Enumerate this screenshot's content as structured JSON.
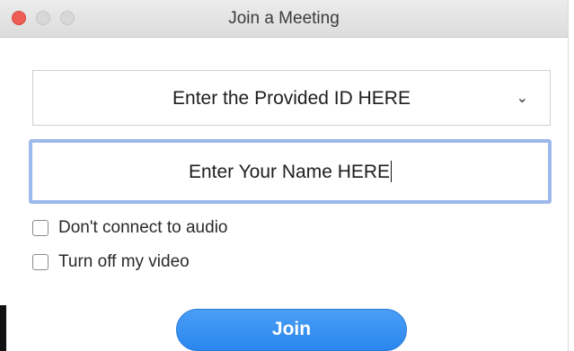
{
  "window": {
    "title": "Join a Meeting"
  },
  "meeting_id": {
    "value": "Enter the Provided ID HERE",
    "chevron_icon": "chevron-down-icon"
  },
  "name_field": {
    "value": "Enter Your Name HERE"
  },
  "options": {
    "audio_label": "Don't connect to audio",
    "audio_checked": false,
    "video_label": "Turn off my video",
    "video_checked": false
  },
  "actions": {
    "join_label": "Join"
  },
  "colors": {
    "accent": "#2a86ee",
    "focus_ring": "#9db8ea",
    "close_button": "#ee5e57"
  }
}
